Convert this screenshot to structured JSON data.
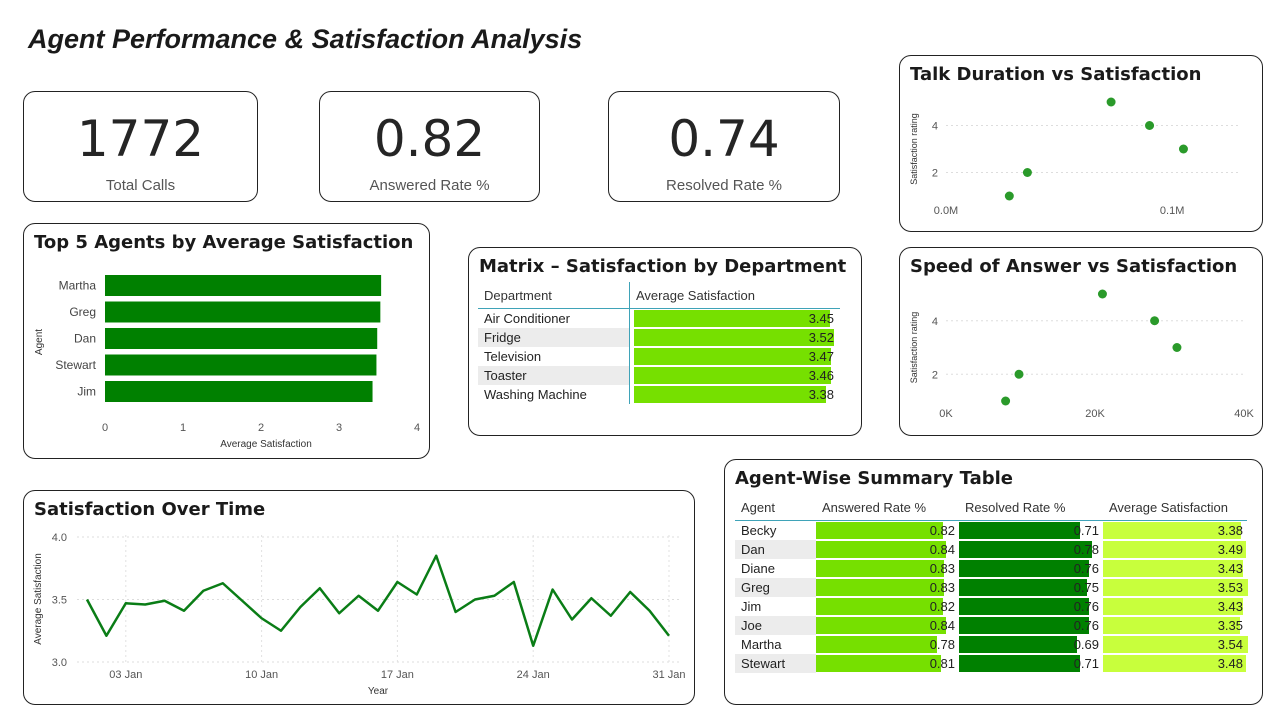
{
  "page_title": "Agent Performance & Satisfaction Analysis",
  "kpis": [
    {
      "value": "1772",
      "label": "Total Calls"
    },
    {
      "value": "0.82",
      "label": "Answered Rate %"
    },
    {
      "value": "0.74",
      "label": "Resolved Rate %"
    }
  ],
  "colors": {
    "bar_dark": "#008000",
    "bar_light": "#76e000",
    "bar_lime": "#c8ff3c",
    "line": "#0a7d16",
    "point": "#2a9a2a",
    "table_rule": "#3fa3b8"
  },
  "chart_data": [
    {
      "type": "bar",
      "orientation": "horizontal",
      "title": "Top 5 Agents by Average Satisfaction",
      "categories": [
        "Martha",
        "Greg",
        "Dan",
        "Stewart",
        "Jim"
      ],
      "values": [
        3.54,
        3.53,
        3.49,
        3.48,
        3.43
      ],
      "xlabel": "Average Satisfaction",
      "ylabel": "Agent",
      "xlim": [
        0,
        4
      ],
      "xticks": [
        "0",
        "1",
        "2",
        "3",
        "4"
      ]
    },
    {
      "type": "table",
      "title": "Matrix – Satisfaction by Department",
      "columns": [
        "Department",
        "Average Satisfaction"
      ],
      "rows": [
        {
          "name": "Air Conditioner",
          "value": "3.45"
        },
        {
          "name": "Fridge",
          "value": "3.52"
        },
        {
          "name": "Television",
          "value": "3.47"
        },
        {
          "name": "Toaster",
          "value": "3.46"
        },
        {
          "name": "Washing Machine",
          "value": "3.38"
        }
      ]
    },
    {
      "type": "scatter",
      "title": "Talk Duration vs Satisfaction",
      "ylabel": "Satisfaction rating",
      "xlim": [
        0,
        130000
      ],
      "ylim": [
        1,
        5
      ],
      "xticks": [
        {
          "v": 0,
          "t": "0.0M"
        },
        {
          "v": 100000,
          "t": "0.1M"
        }
      ],
      "yticks": [
        {
          "v": 2,
          "t": "2"
        },
        {
          "v": 4,
          "t": "4"
        }
      ],
      "points": [
        {
          "x": 73000,
          "y": 5
        },
        {
          "x": 90000,
          "y": 4
        },
        {
          "x": 105000,
          "y": 3
        },
        {
          "x": 36000,
          "y": 2
        },
        {
          "x": 28000,
          "y": 1
        }
      ]
    },
    {
      "type": "scatter",
      "title": "Speed of Answer vs Satisfaction",
      "ylabel": "Satisfaction rating",
      "xlim": [
        0,
        40000
      ],
      "ylim": [
        1,
        5
      ],
      "xticks": [
        {
          "v": 0,
          "t": "0K"
        },
        {
          "v": 20000,
          "t": "20K"
        },
        {
          "v": 40000,
          "t": "40K"
        }
      ],
      "yticks": [
        {
          "v": 2,
          "t": "2"
        },
        {
          "v": 4,
          "t": "4"
        }
      ],
      "points": [
        {
          "x": 21000,
          "y": 5
        },
        {
          "x": 28000,
          "y": 4
        },
        {
          "x": 31000,
          "y": 3
        },
        {
          "x": 9800,
          "y": 2
        },
        {
          "x": 8000,
          "y": 1
        }
      ]
    },
    {
      "type": "line",
      "title": "Satisfaction Over Time",
      "xlabel": "Year",
      "ylabel": "Average Satisfaction",
      "ylim": [
        3.0,
        4.0
      ],
      "yticks": [
        "3.0",
        "3.5",
        "4.0"
      ],
      "xticks": [
        {
          "i": 2,
          "t": "03 Jan"
        },
        {
          "i": 9,
          "t": "10 Jan"
        },
        {
          "i": 16,
          "t": "17 Jan"
        },
        {
          "i": 23,
          "t": "24 Jan"
        },
        {
          "i": 30,
          "t": "31 Jan"
        }
      ],
      "x": [
        "01 Jan",
        "02 Jan",
        "03 Jan",
        "04 Jan",
        "05 Jan",
        "06 Jan",
        "07 Jan",
        "08 Jan",
        "09 Jan",
        "10 Jan",
        "11 Jan",
        "12 Jan",
        "13 Jan",
        "14 Jan",
        "15 Jan",
        "16 Jan",
        "17 Jan",
        "18 Jan",
        "19 Jan",
        "20 Jan",
        "21 Jan",
        "22 Jan",
        "23 Jan",
        "24 Jan",
        "25 Jan",
        "26 Jan",
        "27 Jan",
        "28 Jan",
        "29 Jan",
        "30 Jan",
        "31 Jan"
      ],
      "values": [
        3.5,
        3.21,
        3.47,
        3.46,
        3.49,
        3.41,
        3.57,
        3.63,
        3.49,
        3.35,
        3.25,
        3.44,
        3.59,
        3.39,
        3.53,
        3.41,
        3.64,
        3.54,
        3.85,
        3.4,
        3.5,
        3.53,
        3.64,
        3.13,
        3.58,
        3.34,
        3.51,
        3.37,
        3.56,
        3.41,
        3.21
      ]
    },
    {
      "type": "table",
      "title": "Agent-Wise Summary Table",
      "columns": [
        "Agent",
        "Answered Rate %",
        "Resolved Rate %",
        "Average Satisfaction"
      ],
      "rows": [
        {
          "agent": "Becky",
          "answered": "0.82",
          "resolved": "0.71",
          "satisfaction": "3.38"
        },
        {
          "agent": "Dan",
          "answered": "0.84",
          "resolved": "0.78",
          "satisfaction": "3.49"
        },
        {
          "agent": "Diane",
          "answered": "0.83",
          "resolved": "0.76",
          "satisfaction": "3.43"
        },
        {
          "agent": "Greg",
          "answered": "0.83",
          "resolved": "0.75",
          "satisfaction": "3.53"
        },
        {
          "agent": "Jim",
          "answered": "0.82",
          "resolved": "0.76",
          "satisfaction": "3.43"
        },
        {
          "agent": "Joe",
          "answered": "0.84",
          "resolved": "0.76",
          "satisfaction": "3.35"
        },
        {
          "agent": "Martha",
          "answered": "0.78",
          "resolved": "0.69",
          "satisfaction": "3.54"
        },
        {
          "agent": "Stewart",
          "answered": "0.81",
          "resolved": "0.71",
          "satisfaction": "3.48"
        }
      ]
    }
  ]
}
